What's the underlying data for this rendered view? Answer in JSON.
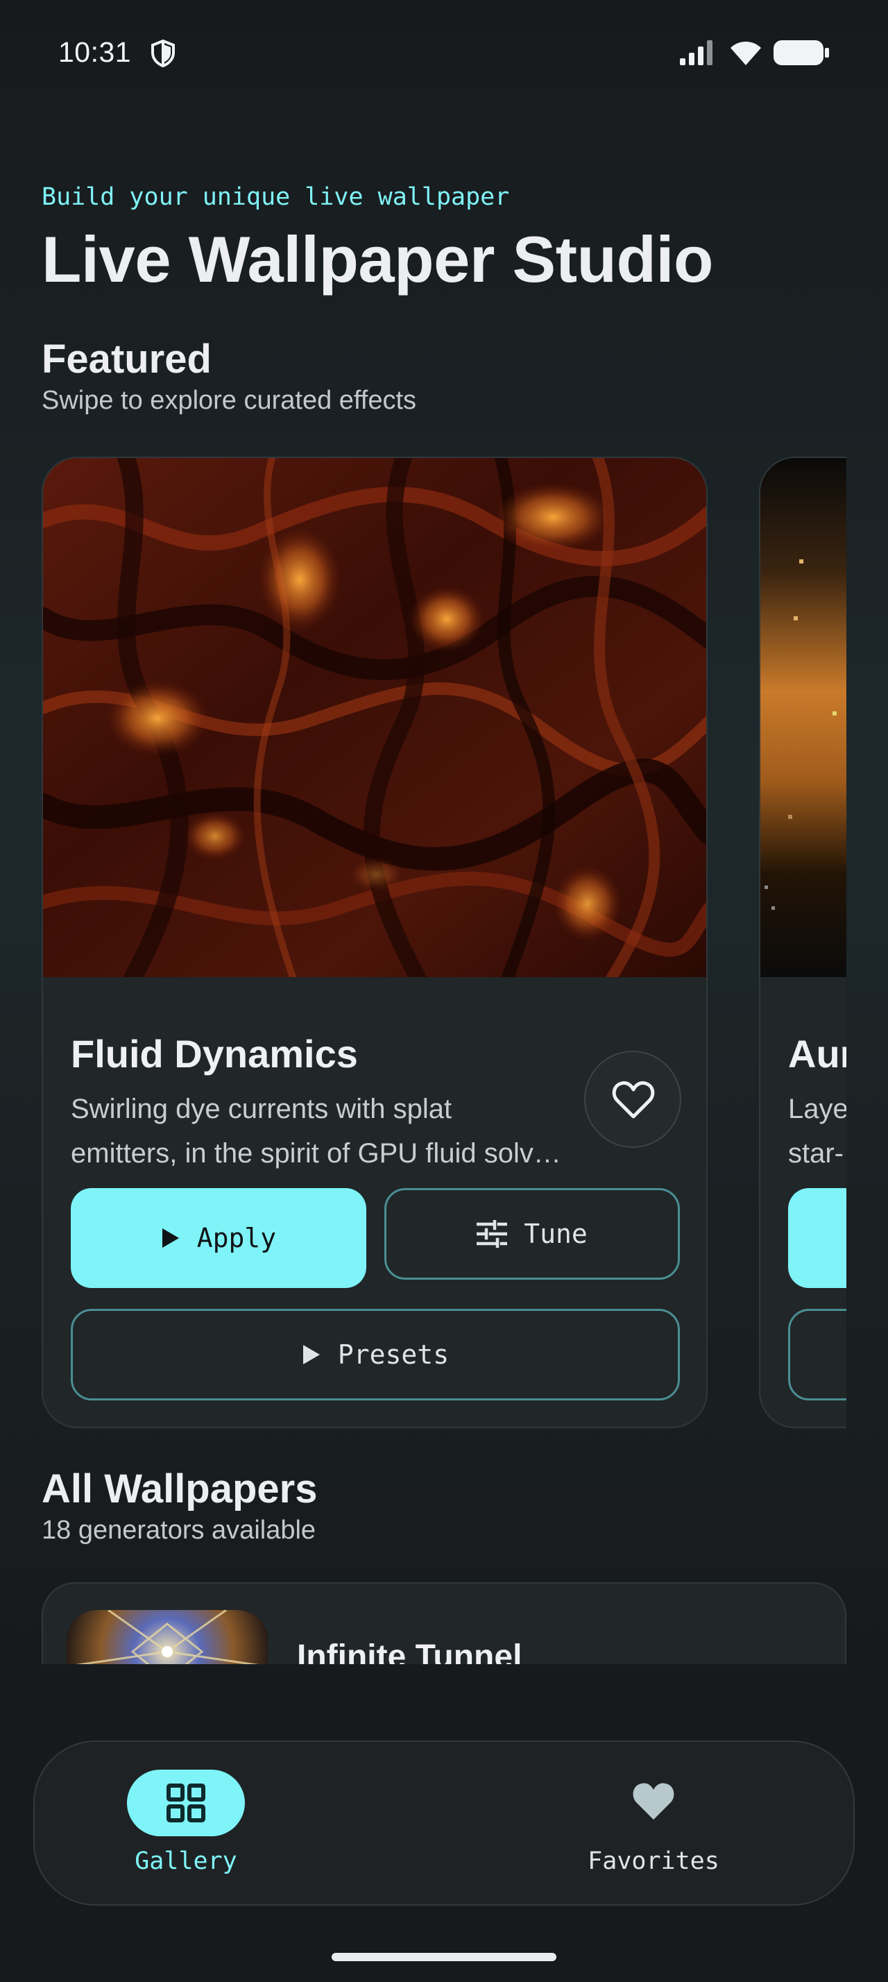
{
  "status_bar": {
    "time": "10:31",
    "icons": [
      "shield-icon",
      "signal-icon",
      "wifi-icon",
      "battery-icon"
    ]
  },
  "header": {
    "tagline": "Build your unique live wallpaper",
    "title": "Live Wallpaper Studio"
  },
  "featured": {
    "title": "Featured",
    "subtitle": "Swipe to explore curated effects",
    "cards": [
      {
        "name": "Fluid Dynamics",
        "description_line1": "Swirling dye currents with splat",
        "description_line2": "emitters, in the spirit of GPU fluid solv…",
        "apply_label": "Apply",
        "tune_label": "Tune",
        "presets_label": "Presets"
      },
      {
        "name": "Aur",
        "description_line1": "Laye",
        "description_line2": "star-"
      }
    ]
  },
  "all_wallpapers": {
    "title": "All Wallpapers",
    "subtitle": "18 generators available",
    "items": [
      {
        "name": "Infinite Tunnel"
      }
    ]
  },
  "bottom_nav": {
    "items": [
      {
        "label": "Gallery",
        "icon": "grid-icon",
        "active": true
      },
      {
        "label": "Favorites",
        "icon": "heart-icon",
        "active": false
      }
    ]
  },
  "colors": {
    "accent": "#7ff4f8",
    "background": "#171a1c",
    "card": "#212628",
    "outline": "#4a8f94"
  }
}
